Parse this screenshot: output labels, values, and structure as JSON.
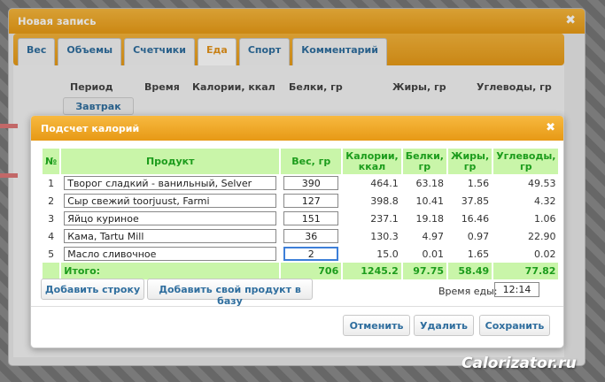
{
  "outer_dialog": {
    "title": "Новая запись",
    "close": "✖",
    "tabs": [
      "Вес",
      "Объемы",
      "Счетчики",
      "Еда",
      "Спорт",
      "Комментарий"
    ],
    "active_tab": "Еда",
    "columns": {
      "period": "Период",
      "time": "Время",
      "calories": "Калории, ккал",
      "protein": "Белки, гр",
      "fat": "Жиры, гр",
      "carbs": "Углеводы, гр"
    },
    "meal": "Завтрак"
  },
  "calc": {
    "title": "Подсчет калорий",
    "close": "✖",
    "headers": {
      "num": "№",
      "product": "Продукт",
      "weight": "Вес, гр",
      "calories": "Калории, ккал",
      "protein": "Белки, гр",
      "fat": "Жиры, гр",
      "carbs": "Углеводы, гр"
    },
    "rows": [
      {
        "n": "1",
        "product": "Творог сладкий - ванильный, Selver",
        "weight": "390",
        "kcal": "464.1",
        "protein": "63.18",
        "fat": "1.56",
        "carbs": "49.53"
      },
      {
        "n": "2",
        "product": "Сыр свежий toorjuust, Farmi",
        "weight": "127",
        "kcal": "398.8",
        "protein": "10.41",
        "fat": "37.85",
        "carbs": "4.32"
      },
      {
        "n": "3",
        "product": "Яйцо куриное",
        "weight": "151",
        "kcal": "237.1",
        "protein": "19.18",
        "fat": "16.46",
        "carbs": "1.06"
      },
      {
        "n": "4",
        "product": "Кама, Tartu Mill",
        "weight": "36",
        "kcal": "130.3",
        "protein": "4.97",
        "fat": "0.97",
        "carbs": "22.90"
      },
      {
        "n": "5",
        "product": "Масло сливочное",
        "weight": "2",
        "kcal": "15.0",
        "protein": "0.01",
        "fat": "1.65",
        "carbs": "0.02"
      }
    ],
    "total": {
      "label": "Итого:",
      "weight": "706",
      "kcal": "1245.2",
      "protein": "97.75",
      "fat": "58.49",
      "carbs": "77.82"
    },
    "add_row": "Добавить строку",
    "add_product": "Добавить свой продукт в базу",
    "time_label": "Время еды:",
    "time_value": "12:14",
    "cancel": "Отменить",
    "delete": "Удалить",
    "save": "Сохранить"
  },
  "watermark": "Calorizator.ru",
  "colors": {
    "accent_orange": "#e89b16",
    "header_green_bg": "#c9f5a9",
    "header_green_text": "#1c9c1c",
    "link_blue": "#2f6e9e"
  }
}
